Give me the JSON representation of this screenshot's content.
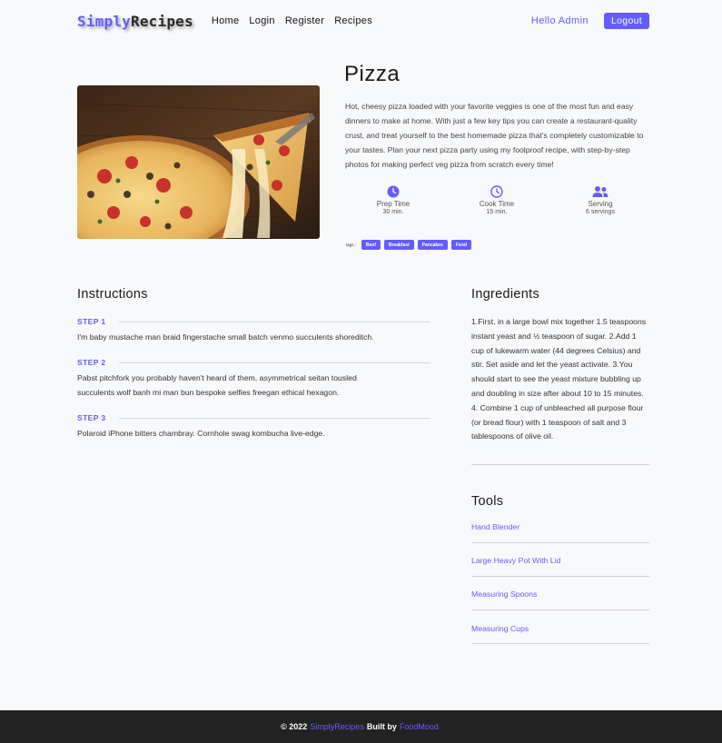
{
  "nav": {
    "logo_primary": "Simply",
    "logo_secondary": "Recipes",
    "links": [
      "Home",
      "Login",
      "Register",
      "Recipes"
    ],
    "greeting": "Hello Admin",
    "logout_label": "Logout"
  },
  "recipe": {
    "title": "Pizza",
    "description": "Hot, cheesy pizza loaded with your favorite veggies is one of the most fun and easy dinners to make at home. With just a few key tips you can create a restaurant-quality crust, and treat yourself to the best homemade pizza that's completely customizable to your tastes. Plan your next pizza party using my foolproof recipe, with step-by-step photos for making perfect veg pizza from scratch every time!",
    "stats": [
      {
        "icon": "clock-icon",
        "label": "Prep Time",
        "value": "30 min."
      },
      {
        "icon": "clock-outline-icon",
        "label": "Cook Time",
        "value": "15 min."
      },
      {
        "icon": "users-icon",
        "label": "Serving",
        "value": "6 servings"
      }
    ],
    "tags_label": "tags :",
    "tags": [
      "Beef",
      "Breakfast",
      "Pancakes",
      "Food"
    ]
  },
  "instructions": {
    "heading": "Instructions",
    "steps": [
      {
        "label": "STEP 1",
        "text": "I'm baby mustache man braid fingerstache small batch venmo succulents shoreditch."
      },
      {
        "label": "STEP 2",
        "text": "Pabst pitchfork you probably haven't heard of them, asymmetrical seitan tousled succulents wolf banh mi man bun bespoke selfies freegan ethical hexagon."
      },
      {
        "label": "STEP 3",
        "text": "Polaroid iPhone bitters chambray. Cornhole swag kombucha live-edge."
      }
    ]
  },
  "ingredients": {
    "heading": "Ingredients",
    "text": "1.First, in a large bowl mix together 1.5 teaspoons instant yeast and ½ teaspoon of sugar. 2.Add 1 cup of lukewarm water (44 degrees Celsius) and stir. Set aside and let the yeast activate. 3.You should start to see the yeast mixture bubbling up and doubling in size after about 10 to 15 minutes. 4. Combine 1 cup of unbleached all purpose flour (or bread flour) with 1 teaspoon of salt and 3 tablespoons of olive oil."
  },
  "tools": {
    "heading": "Tools",
    "items": [
      "Hand Blender",
      "Large Heavy Pot With Lid",
      "Measuring Spoons",
      "Measuring Cups"
    ]
  },
  "footer": {
    "copyright": "© 2022",
    "brand": "SimplyRecipes",
    "built_by": "Built by",
    "author": "FoodMood"
  },
  "colors": {
    "accent": "#645cff",
    "footer_bg": "#222222",
    "page_bg": "#f8f9fb"
  }
}
